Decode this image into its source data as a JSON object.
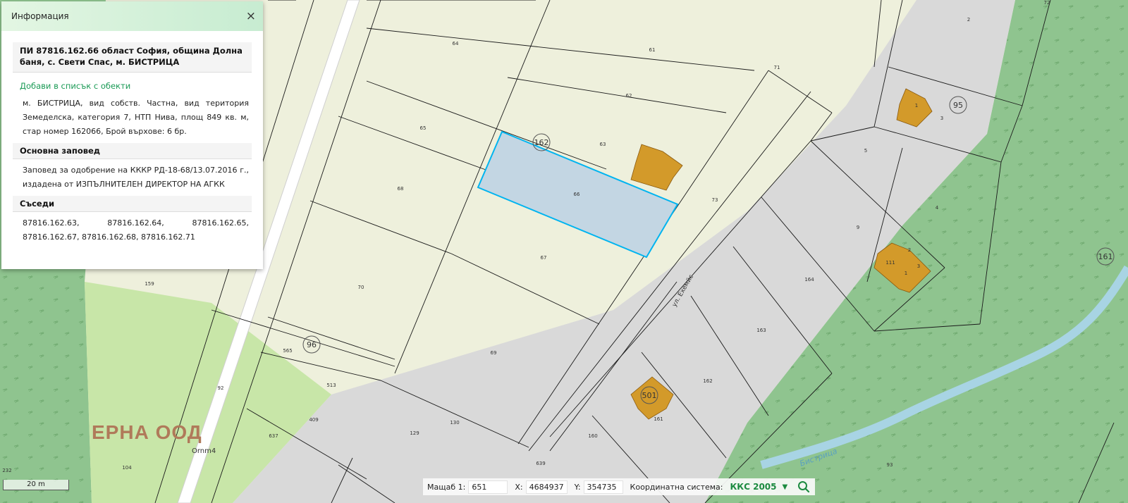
{
  "info_panel": {
    "title": "Информация",
    "close_symbol": "×",
    "parcel_heading": "ПИ 87816.162.66 област София, община Долна баня, с. Свети Спас, м. БИСТРИЦА",
    "add_link": "Добави в списък с обекти",
    "description": "м. БИСТРИЦА, вид собств. Частна, вид територия Земеделска, категория 7, НТП Нива, площ 849 кв. м, стар номер 162066, Брой върхове: 6 бр.",
    "order_heading": "Основна заповед",
    "order_text": "Заповед за одобрение на КККР РД-18-68/13.07.2016 г., издадена от ИЗПЪЛНИТЕЛЕН ДИРЕКТОР НА АГКК",
    "neighbors_heading": "Съседи",
    "neighbors_text": "87816.162.63, 87816.162.64, 87816.162.65, 87816.162.67, 87816.162.68, 87816.162.71"
  },
  "status_bar": {
    "scale_label": "Мащаб 1:",
    "scale_value": "651",
    "x_label": "X:",
    "x_value": "4684937",
    "y_label": "Y:",
    "y_value": "354735",
    "coord_label": "Координатна система:",
    "coord_value": "ККС 2005"
  },
  "scale_bar": {
    "label": "20 m"
  },
  "map": {
    "watermark": "ЕРНА ООД",
    "tree_label": "Ornm4",
    "street_label": "ул. Ехемйс",
    "river_label": "Бистрица",
    "block_labels": [
      "162",
      "95",
      "96",
      "161",
      "501"
    ],
    "parcel_labels": [
      "64",
      "61",
      "62",
      "63",
      "65",
      "66",
      "67",
      "68",
      "69",
      "70",
      "71",
      "72",
      "73",
      "1",
      "2",
      "3",
      "4",
      "5",
      "9",
      "164",
      "163",
      "162",
      "161",
      "160",
      "159",
      "92",
      "565",
      "513",
      "409",
      "129",
      "130",
      "639",
      "637",
      "232",
      "104",
      "93",
      "111",
      "1",
      "2",
      "3",
      "4"
    ],
    "colors": {
      "cream": "#eef0dc",
      "forest": "#8fc48f",
      "light_green": "#c8e6a8",
      "gray_zone": "#d9d9d9",
      "selected_fill": "#c3d6e3",
      "selected_border": "#00b4f0",
      "building": "#d39a2a",
      "river": "#a8d4e4"
    }
  }
}
